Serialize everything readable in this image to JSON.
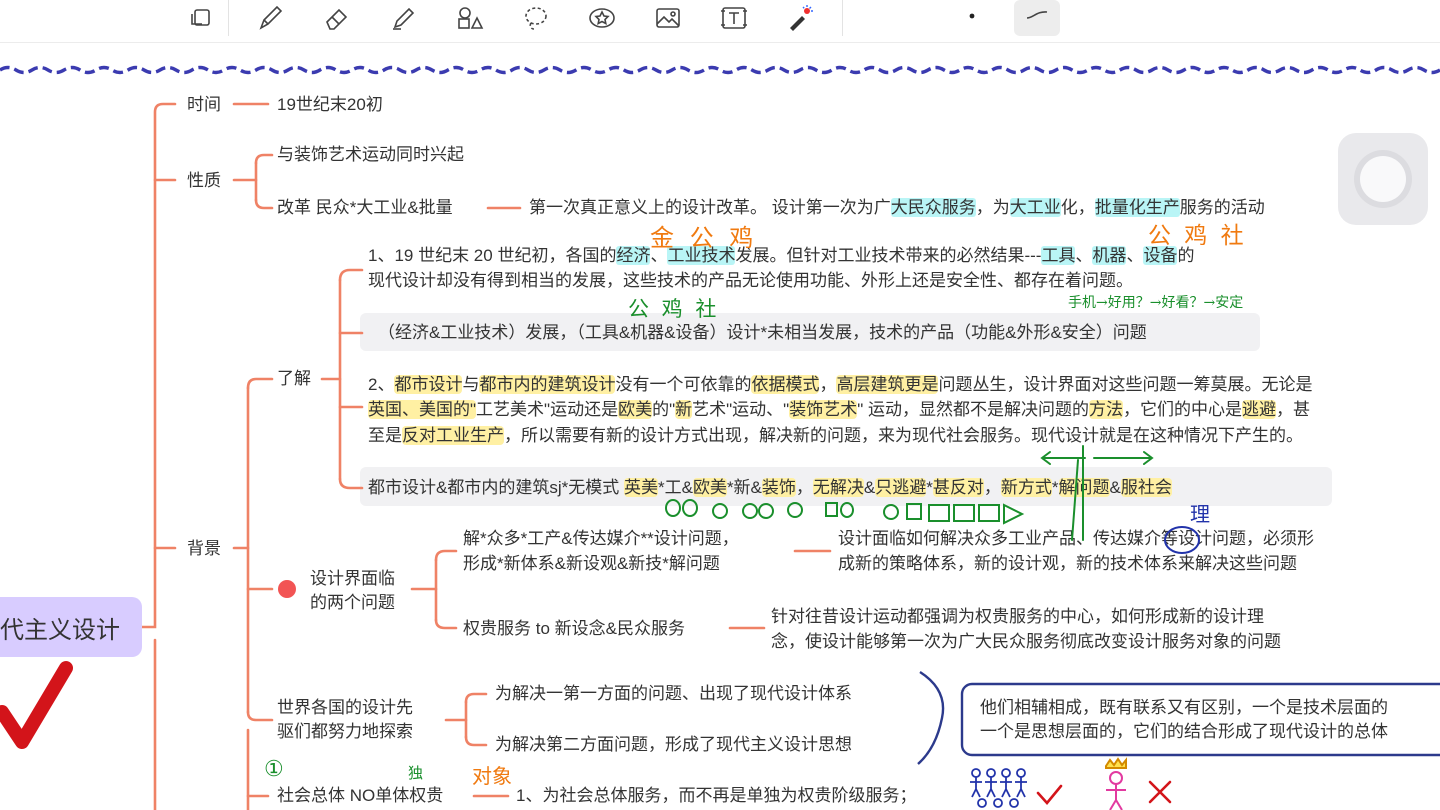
{
  "toolbar": {
    "tools": [
      "lasso-select",
      "pen",
      "eraser",
      "highlighter",
      "shapes",
      "lasso",
      "sticker",
      "image",
      "text",
      "laser-pointer"
    ],
    "pen_options": [
      "dot-size",
      "stroke-style"
    ]
  },
  "mindmap": {
    "central_node": "代主义设计",
    "time_label": "时间",
    "time_value": "19世纪末20初",
    "nature_label": "性质",
    "nature_item1": "与装饰艺术运动同时兴起",
    "nature_item2": "改革 民众*大工业&批量",
    "nature_desc": {
      "p1": "第一次真正意义上的设计改革。 设计第一次为广",
      "h1": "大民众服务",
      "p2": "，为",
      "h2": "大工业",
      "p3": "化，",
      "h3": "批量化生产",
      "p4": "服务的活动"
    },
    "background_label": "背景",
    "understand_label": "了解",
    "para1": {
      "a": "1、19 世纪末 20 世纪初，各国的",
      "b": "经济",
      "c": "、",
      "d": "工业技术",
      "e": "发展。但针对工业技术带来的必然结果---",
      "f": "工具",
      "g": "、",
      "h": "机器",
      "i": "、",
      "j": "设备",
      "k": "的",
      "line2": "现代设计却没有得到相当的发展，这些技术的产品无论使用功能、外形上还是安全性、都存在着问题。"
    },
    "summary1": "（经济&工业技术）发展，（工具&机器&设备）设计*未相当发展，技术的产品（功能&外形&安全）问题",
    "para2": {
      "l1": [
        {
          "t": "2、",
          "h": false
        },
        {
          "t": "都市设计",
          "h": true
        },
        {
          "t": "与",
          "h": false
        },
        {
          "t": "都市内的建筑设计",
          "h": true
        },
        {
          "t": "没有一个可依靠的",
          "h": false
        },
        {
          "t": "依据模式",
          "h": true
        },
        {
          "t": "，",
          "h": false
        },
        {
          "t": "高层建筑更是",
          "h": true
        },
        {
          "t": "问题丛生，设计界面对这些问题一筹莫展。无论是",
          "h": false
        }
      ],
      "l2": [
        {
          "t": "英国、美国的\"",
          "h": true
        },
        {
          "t": "工艺美术\"运动还是",
          "h": false
        },
        {
          "t": "欧美",
          "h": true
        },
        {
          "t": "的\"",
          "h": false
        },
        {
          "t": "新",
          "h": true
        },
        {
          "t": "艺术\"运动、\"",
          "h": false
        },
        {
          "t": "装饰艺术",
          "h": true
        },
        {
          "t": "\" 运动",
          "h": false
        },
        {
          "t": "，显然都不是解决问题的",
          "h": false
        },
        {
          "t": "方法",
          "h": true
        },
        {
          "t": "，它们的中心是",
          "h": false
        },
        {
          "t": "逃避",
          "h": true
        },
        {
          "t": "，甚",
          "h": false
        }
      ],
      "l3": [
        {
          "t": "至是",
          "h": false
        },
        {
          "t": "反对工业生产",
          "h": true
        },
        {
          "t": "，所以需要有新的设计方式出现，解决新的问题，来为现代社会服务。现代设计就是在这种情况下产生的。",
          "h": false
        }
      ]
    },
    "summary2": [
      {
        "t": "都市设计&都市内的建筑sj*无模式  ",
        "h": false
      },
      {
        "t": "英美",
        "h": true
      },
      {
        "t": "*工&",
        "h": false
      },
      {
        "t": "欧美",
        "h": true
      },
      {
        "t": "*新&",
        "h": false
      },
      {
        "t": "装饰",
        "h": true
      },
      {
        "t": "，",
        "h": false
      },
      {
        "t": "无解决",
        "h": true
      },
      {
        "t": "&",
        "h": false
      },
      {
        "t": "只逃避",
        "h": true
      },
      {
        "t": "*",
        "h": false
      },
      {
        "t": "甚反对",
        "h": true
      },
      {
        "t": "，",
        "h": false
      },
      {
        "t": "新方式",
        "h": true
      },
      {
        "t": "*",
        "h": false
      },
      {
        "t": "解问题",
        "h": true
      },
      {
        "t": "&",
        "h": false
      },
      {
        "t": "服社会",
        "h": true
      }
    ],
    "two_problems_label_l1": "设计界面临",
    "two_problems_label_l2": "的两个问题",
    "problem1_l1": "解*众多*工产&传达媒介**设计问题，",
    "problem1_l2": "形成*新体系&新设观&新技*解问题",
    "problem1_desc_l1": "设计面临如何解决众多工业产品、传达媒介等设计问题，必须形",
    "problem1_desc_l2": "成新的策略体系，新的设计观，新的技术体系来解决这些问题",
    "problem2": "权贵服务 to 新设念&民众服务",
    "problem2_desc_l1": "针对往昔设计运动都强调为权贵服务的中心，如何形成新的设计理",
    "problem2_desc_l2": "念，使设计能够第一次为广大民众服务彻底改变设计服务对象的问题",
    "pioneers_l1": "世界各国的设计先",
    "pioneers_l2": "驱们都努力地探索",
    "pioneer_item1": "为解决一第一方面的问题、出现了现代设计体系",
    "pioneer_item2": "为解决第二方面问题，形成了现代主义设计思想",
    "pioneer_summary_l1": "他们相辅相成，既有联系又有区别，一个是技术层面的",
    "pioneer_summary_l2": "一个是思想层面的，它们的结合形成了现代设计的总体",
    "society_label": "社会总体 NO单体权贵",
    "society_desc": "1、为社会总体服务，而不再是单独为权贵阶级服务；"
  },
  "handwriting": {
    "note_econ": "金 公 鸡",
    "note_tools": "公  鸡    社",
    "note_summary": "公   鸡   社",
    "note_chain": "手机→好用？→好看？→安定",
    "note_media": "理",
    "note_num": "①",
    "note_du": "独",
    "note_duixiang": "对象"
  },
  "colors": {
    "branch": "#ef8266",
    "dot": "#f25454",
    "central_bg": "#d8ccff",
    "highlight_yellow": "#fff0a3",
    "highlight_cyan": "#b9f5f6",
    "pen_orange": "#f07a10",
    "pen_green": "#1a8f2c",
    "pen_blue": "#2233aa",
    "check_red": "#d3141a",
    "dashed_line": "#3b3bb0"
  }
}
